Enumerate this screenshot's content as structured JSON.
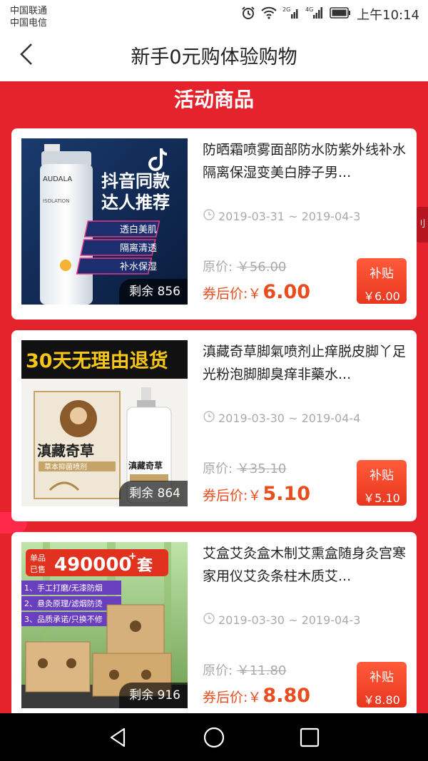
{
  "status": {
    "carrier1": "中国联通",
    "carrier2": "中国电信",
    "net1": "2G",
    "net2": "4G",
    "time": "上午10:14",
    "icons": [
      "alarm-icon",
      "wifi-icon",
      "signal-icon",
      "battery-icon"
    ]
  },
  "header": {
    "title": "新手0元购体验购物"
  },
  "section": {
    "title": "活动商品"
  },
  "side_tab": {
    "label": "刂"
  },
  "products": [
    {
      "name": "防晒霜喷雾面部防水防紫外线补水隔离保湿变美白脖子男...",
      "date": "2019-03-31 ~ 2019-04-3",
      "original_label": "原价:",
      "original_price": "￥56.00",
      "after_label": "券后价:",
      "currency": "￥",
      "after_price": "6.00",
      "subsidy_label": "补贴",
      "subsidy_amount": "￥6.00",
      "remain": "剩余 856",
      "img": {
        "brand": "AUDALA",
        "sub": "ISOLATION",
        "badge1": "抖音同款",
        "badge2": "达人推荐",
        "tags": [
          "透白美肌",
          "隔离清透",
          "补水保湿"
        ]
      }
    },
    {
      "name": "滇藏奇草脚氣喷剂止痒脱皮脚丫足光粉泡脚脚臭痒非藥水...",
      "date": "2019-03-30 ~ 2019-04-4",
      "original_label": "原价:",
      "original_price": "￥35.10",
      "after_label": "券后价:",
      "currency": "￥",
      "after_price": "5.10",
      "subsidy_label": "补贴",
      "subsidy_amount": "￥5.10",
      "remain": "剩余 864",
      "img": {
        "banner": "30天无理由退货",
        "box": "滇藏奇草",
        "spray": "滇藏奇草",
        "plaque": "草本抑菌喷剂"
      }
    },
    {
      "name": "艾盒艾灸盒木制艾熏盒随身灸宫寒家用仪艾灸条柱木质艾...",
      "date": "2019-03-30 ~ 2019-04-3",
      "original_label": "原价:",
      "original_price": "￥11.80",
      "after_label": "券后价:",
      "currency": "￥",
      "after_price": "8.80",
      "subsidy_label": "补贴",
      "subsidy_amount": "￥8.80",
      "remain": "剩余 916",
      "img": {
        "sold1": "单品",
        "sold2": "已售",
        "count": "490000",
        "plus": "+",
        "unit": "套",
        "features": [
          "1、手工打磨/无漆防烟",
          "2、悬灸原理/滤烟防烫",
          "3、品质承诺/只换不修"
        ]
      }
    }
  ],
  "nav": {
    "icons": [
      "back-triangle-icon",
      "home-circle-icon",
      "recents-square-icon"
    ]
  },
  "colors": {
    "brand_red": "#e5232d",
    "price_orange": "#e94d1d",
    "subsidy": "#ff5b3a"
  }
}
